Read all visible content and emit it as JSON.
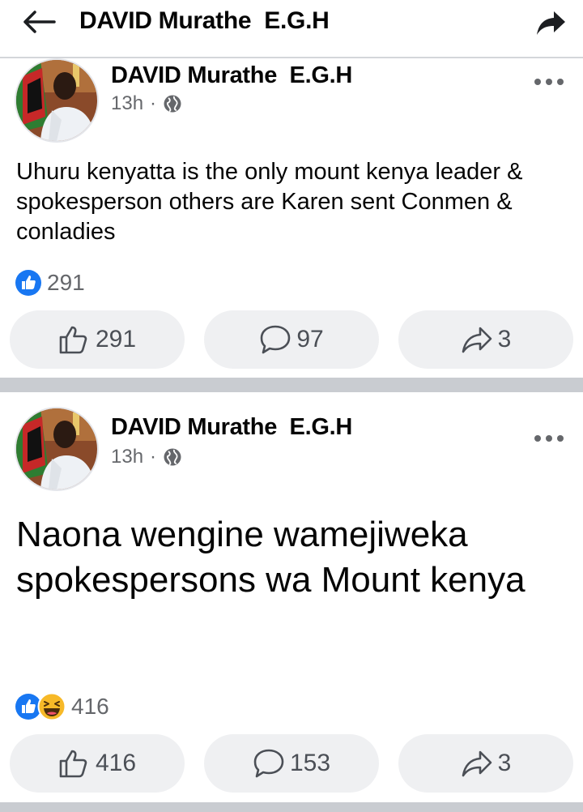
{
  "header": {
    "title": "DAVID Murathe  E.G.H"
  },
  "posts": [
    {
      "author": "DAVID Murathe  E.G.H",
      "time": "13h",
      "separator": "·",
      "text": "Uhuru kenyatta is the only mount kenya leader & spokesperson others are Karen sent Conmen & conladies",
      "reaction_count": "291",
      "like_count": "291",
      "comment_count": "97",
      "share_count": "3"
    },
    {
      "author": "DAVID Murathe  E.G.H",
      "time": "13h",
      "separator": "·",
      "text": "Naona wengine wamejiweka spokespersons wa Mount kenya",
      "reaction_count": "416",
      "like_count": "416",
      "comment_count": "153",
      "share_count": "3"
    }
  ],
  "colors": {
    "like_blue": "#1877f2",
    "haha_yellow": "#f7b928",
    "button_bg": "#eff0f2",
    "separator": "#c9ccd1"
  },
  "icons": [
    "back-arrow-icon",
    "share-icon",
    "globe-icon",
    "more-icon",
    "like-reaction-icon",
    "haha-reaction-icon",
    "thumbs-up-icon",
    "comment-icon",
    "share-arrow-icon"
  ]
}
